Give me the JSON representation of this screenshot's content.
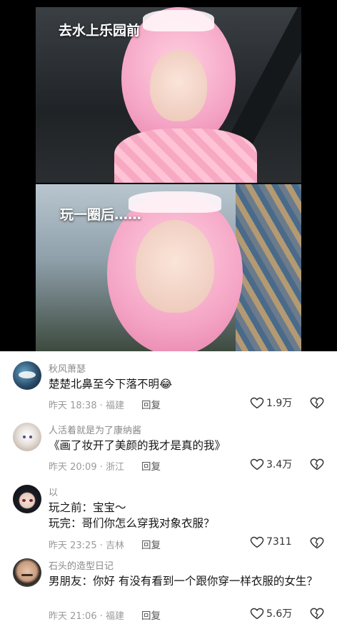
{
  "video": {
    "caption_top": "去水上乐园前",
    "caption_bottom": "玩一圈后……"
  },
  "comments": [
    {
      "username": "秋风萧瑟",
      "lines": [
        "楚楚北鼻至今下落不明"
      ],
      "emoji": "😂",
      "time": "昨天 18:38",
      "location": "福建",
      "reply_label": "回复",
      "likes": "1.9万"
    },
    {
      "username": "人活着就是为了康纳酱",
      "lines": [
        "《画了妆开了美颜的我才是真的我》"
      ],
      "time": "昨天 20:09",
      "location": "浙江",
      "reply_label": "回复",
      "likes": "3.4万"
    },
    {
      "username": "以",
      "lines": [
        "玩之前：宝宝～",
        "玩完：哥们你怎么穿我对象衣服？"
      ],
      "time": "昨天 23:25",
      "location": "吉林",
      "reply_label": "回复",
      "likes": "7311"
    },
    {
      "username": "石头的造型日记",
      "lines": [
        "男朋友：你好 有没有看到一个跟你穿一样衣服的女生？"
      ],
      "time": "昨天 21:06",
      "location": "福建",
      "reply_label": "回复",
      "likes": "5.6万"
    }
  ],
  "icons": {
    "like": "heart-outline-icon",
    "dislike": "broken-heart-outline-icon"
  },
  "colors": {
    "text_primary": "#161616",
    "text_secondary": "#8a8a8a",
    "background": "#ffffff"
  }
}
